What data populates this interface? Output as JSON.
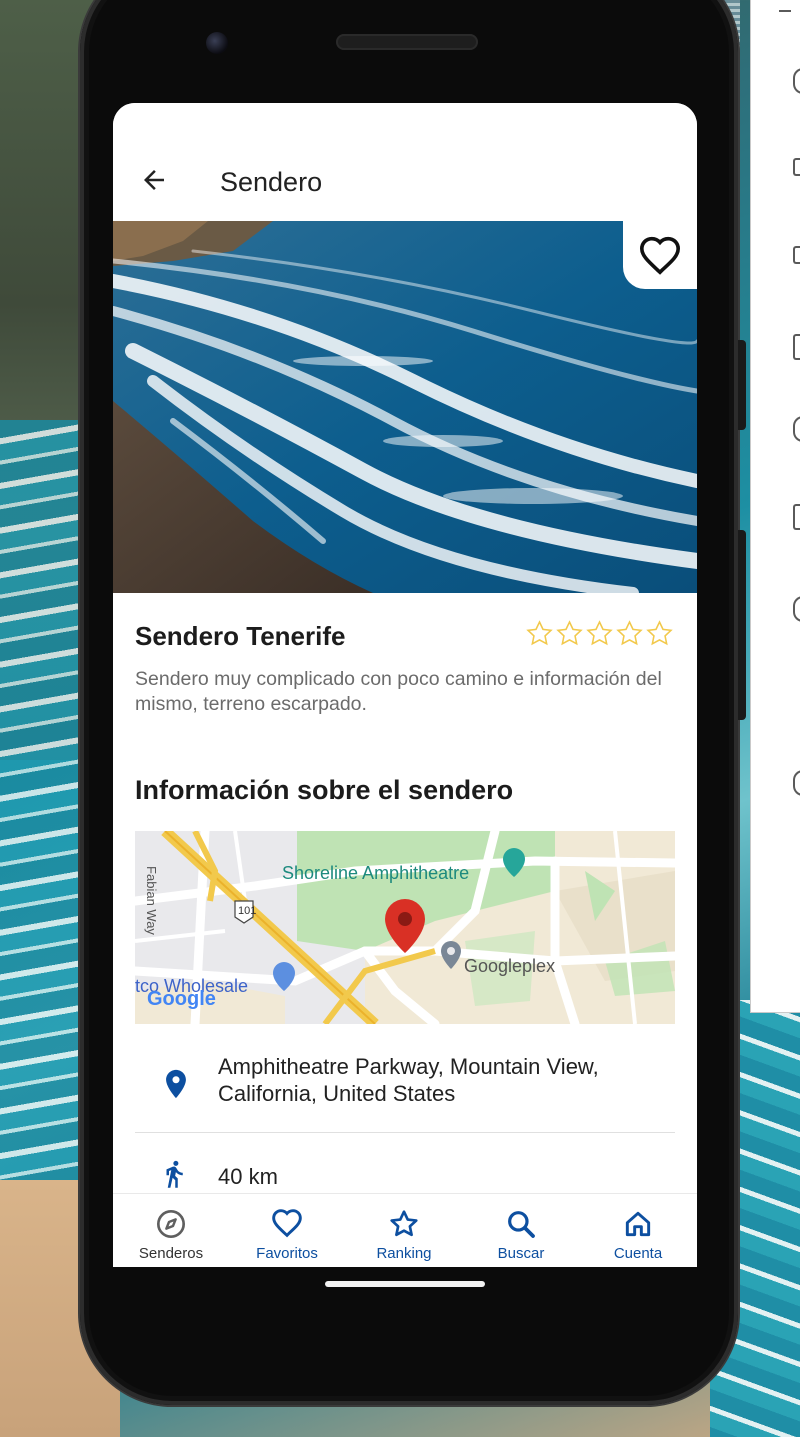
{
  "appbar": {
    "title": "Sendero"
  },
  "trail": {
    "name": "Sendero Tenerife",
    "description": "Sendero muy complicado con poco camino e información del mismo, terreno escarpado.",
    "rating": 0,
    "rating_max": 5
  },
  "section": {
    "title": "Información sobre el sendero"
  },
  "map": {
    "labels": {
      "shoreline": "Shoreline Amphitheatre",
      "googleplex": "Googleplex",
      "wholesale": "tco Wholesale",
      "fabian": "Fabian Way",
      "highway": "101",
      "google": "Google"
    }
  },
  "info": {
    "address": "Amphitheatre Parkway, Mountain View, California, United States",
    "distance": "40 km"
  },
  "nav": {
    "items": [
      {
        "label": "Senderos",
        "icon": "compass-icon"
      },
      {
        "label": "Favoritos",
        "icon": "heart-icon"
      },
      {
        "label": "Ranking",
        "icon": "star-icon"
      },
      {
        "label": "Buscar",
        "icon": "search-icon"
      },
      {
        "label": "Cuenta",
        "icon": "home-icon"
      }
    ]
  },
  "colors": {
    "accent": "#0d4fa0",
    "nav_inactive": "#5f5f5f",
    "star_outline": "#f2c94c",
    "map_pin": "#d93025"
  }
}
